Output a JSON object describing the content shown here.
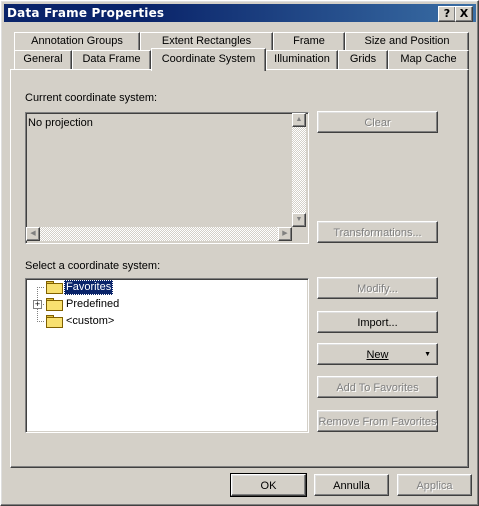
{
  "window": {
    "title": "Data Frame Properties",
    "help_btn": "?",
    "close_btn": "X"
  },
  "tabs_back": [
    "Annotation Groups",
    "Extent Rectangles",
    "Frame",
    "Size and Position"
  ],
  "tabs_front": [
    "General",
    "Data Frame",
    "Coordinate System",
    "Illumination",
    "Grids",
    "Map Cache"
  ],
  "active_tab": "Coordinate System",
  "current": {
    "label": "Current coordinate system:",
    "value": "No projection",
    "clear_btn": "Clear",
    "transformations_btn": "Transformations..."
  },
  "select": {
    "label": "Select a coordinate system:",
    "tree": [
      "Favorites",
      "Predefined",
      "<custom>"
    ],
    "selected": "Favorites"
  },
  "buttons": {
    "modify": "Modify...",
    "import": "Import...",
    "new": "New",
    "add_fav": "Add To Favorites",
    "remove_fav": "Remove From Favorites"
  },
  "footer": {
    "ok": "OK",
    "annulla": "Annulla",
    "applica": "Applica"
  },
  "colors": {
    "title_bar": "#0a246a",
    "face": "#d4d0c8",
    "selection": "#0a246a"
  }
}
